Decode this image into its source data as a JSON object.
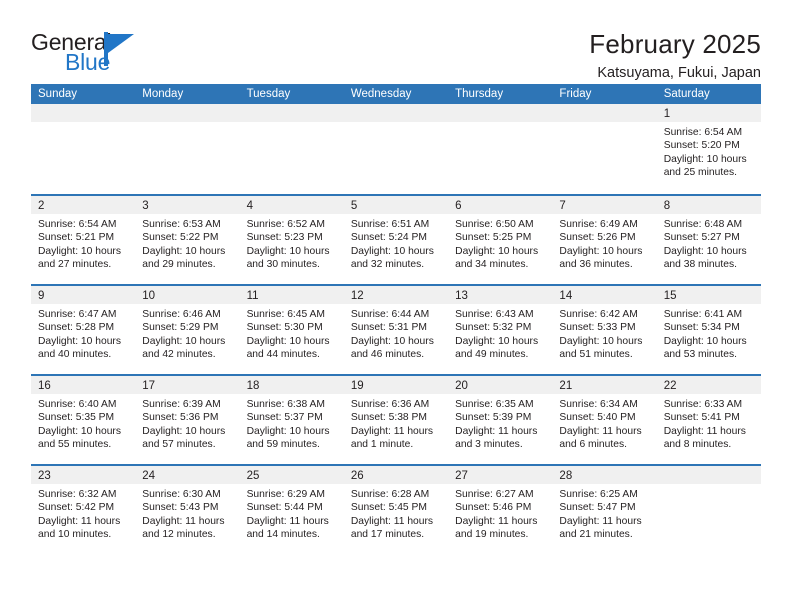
{
  "logo": {
    "text_primary": "General",
    "text_secondary": "Blue",
    "mark": "blue-triangle-flag",
    "color": "#2176c7"
  },
  "header": {
    "month_title": "February 2025",
    "location": "Katsuyama, Fukui, Japan"
  },
  "theme": {
    "header_blue": "#2e75b6",
    "row_divider_blue": "#2e75b6",
    "daynum_band": "#f0f0f0",
    "text": "#231f20"
  },
  "weekdays": [
    "Sunday",
    "Monday",
    "Tuesday",
    "Wednesday",
    "Thursday",
    "Friday",
    "Saturday"
  ],
  "weeks": [
    [
      {
        "day": "",
        "sunrise": "",
        "sunset": "",
        "daylight_a": "",
        "daylight_b": ""
      },
      {
        "day": "",
        "sunrise": "",
        "sunset": "",
        "daylight_a": "",
        "daylight_b": ""
      },
      {
        "day": "",
        "sunrise": "",
        "sunset": "",
        "daylight_a": "",
        "daylight_b": ""
      },
      {
        "day": "",
        "sunrise": "",
        "sunset": "",
        "daylight_a": "",
        "daylight_b": ""
      },
      {
        "day": "",
        "sunrise": "",
        "sunset": "",
        "daylight_a": "",
        "daylight_b": ""
      },
      {
        "day": "",
        "sunrise": "",
        "sunset": "",
        "daylight_a": "",
        "daylight_b": ""
      },
      {
        "day": "1",
        "sunrise": "Sunrise: 6:54 AM",
        "sunset": "Sunset: 5:20 PM",
        "daylight_a": "Daylight: 10 hours",
        "daylight_b": "and 25 minutes."
      }
    ],
    [
      {
        "day": "2",
        "sunrise": "Sunrise: 6:54 AM",
        "sunset": "Sunset: 5:21 PM",
        "daylight_a": "Daylight: 10 hours",
        "daylight_b": "and 27 minutes."
      },
      {
        "day": "3",
        "sunrise": "Sunrise: 6:53 AM",
        "sunset": "Sunset: 5:22 PM",
        "daylight_a": "Daylight: 10 hours",
        "daylight_b": "and 29 minutes."
      },
      {
        "day": "4",
        "sunrise": "Sunrise: 6:52 AM",
        "sunset": "Sunset: 5:23 PM",
        "daylight_a": "Daylight: 10 hours",
        "daylight_b": "and 30 minutes."
      },
      {
        "day": "5",
        "sunrise": "Sunrise: 6:51 AM",
        "sunset": "Sunset: 5:24 PM",
        "daylight_a": "Daylight: 10 hours",
        "daylight_b": "and 32 minutes."
      },
      {
        "day": "6",
        "sunrise": "Sunrise: 6:50 AM",
        "sunset": "Sunset: 5:25 PM",
        "daylight_a": "Daylight: 10 hours",
        "daylight_b": "and 34 minutes."
      },
      {
        "day": "7",
        "sunrise": "Sunrise: 6:49 AM",
        "sunset": "Sunset: 5:26 PM",
        "daylight_a": "Daylight: 10 hours",
        "daylight_b": "and 36 minutes."
      },
      {
        "day": "8",
        "sunrise": "Sunrise: 6:48 AM",
        "sunset": "Sunset: 5:27 PM",
        "daylight_a": "Daylight: 10 hours",
        "daylight_b": "and 38 minutes."
      }
    ],
    [
      {
        "day": "9",
        "sunrise": "Sunrise: 6:47 AM",
        "sunset": "Sunset: 5:28 PM",
        "daylight_a": "Daylight: 10 hours",
        "daylight_b": "and 40 minutes."
      },
      {
        "day": "10",
        "sunrise": "Sunrise: 6:46 AM",
        "sunset": "Sunset: 5:29 PM",
        "daylight_a": "Daylight: 10 hours",
        "daylight_b": "and 42 minutes."
      },
      {
        "day": "11",
        "sunrise": "Sunrise: 6:45 AM",
        "sunset": "Sunset: 5:30 PM",
        "daylight_a": "Daylight: 10 hours",
        "daylight_b": "and 44 minutes."
      },
      {
        "day": "12",
        "sunrise": "Sunrise: 6:44 AM",
        "sunset": "Sunset: 5:31 PM",
        "daylight_a": "Daylight: 10 hours",
        "daylight_b": "and 46 minutes."
      },
      {
        "day": "13",
        "sunrise": "Sunrise: 6:43 AM",
        "sunset": "Sunset: 5:32 PM",
        "daylight_a": "Daylight: 10 hours",
        "daylight_b": "and 49 minutes."
      },
      {
        "day": "14",
        "sunrise": "Sunrise: 6:42 AM",
        "sunset": "Sunset: 5:33 PM",
        "daylight_a": "Daylight: 10 hours",
        "daylight_b": "and 51 minutes."
      },
      {
        "day": "15",
        "sunrise": "Sunrise: 6:41 AM",
        "sunset": "Sunset: 5:34 PM",
        "daylight_a": "Daylight: 10 hours",
        "daylight_b": "and 53 minutes."
      }
    ],
    [
      {
        "day": "16",
        "sunrise": "Sunrise: 6:40 AM",
        "sunset": "Sunset: 5:35 PM",
        "daylight_a": "Daylight: 10 hours",
        "daylight_b": "and 55 minutes."
      },
      {
        "day": "17",
        "sunrise": "Sunrise: 6:39 AM",
        "sunset": "Sunset: 5:36 PM",
        "daylight_a": "Daylight: 10 hours",
        "daylight_b": "and 57 minutes."
      },
      {
        "day": "18",
        "sunrise": "Sunrise: 6:38 AM",
        "sunset": "Sunset: 5:37 PM",
        "daylight_a": "Daylight: 10 hours",
        "daylight_b": "and 59 minutes."
      },
      {
        "day": "19",
        "sunrise": "Sunrise: 6:36 AM",
        "sunset": "Sunset: 5:38 PM",
        "daylight_a": "Daylight: 11 hours",
        "daylight_b": "and 1 minute."
      },
      {
        "day": "20",
        "sunrise": "Sunrise: 6:35 AM",
        "sunset": "Sunset: 5:39 PM",
        "daylight_a": "Daylight: 11 hours",
        "daylight_b": "and 3 minutes."
      },
      {
        "day": "21",
        "sunrise": "Sunrise: 6:34 AM",
        "sunset": "Sunset: 5:40 PM",
        "daylight_a": "Daylight: 11 hours",
        "daylight_b": "and 6 minutes."
      },
      {
        "day": "22",
        "sunrise": "Sunrise: 6:33 AM",
        "sunset": "Sunset: 5:41 PM",
        "daylight_a": "Daylight: 11 hours",
        "daylight_b": "and 8 minutes."
      }
    ],
    [
      {
        "day": "23",
        "sunrise": "Sunrise: 6:32 AM",
        "sunset": "Sunset: 5:42 PM",
        "daylight_a": "Daylight: 11 hours",
        "daylight_b": "and 10 minutes."
      },
      {
        "day": "24",
        "sunrise": "Sunrise: 6:30 AM",
        "sunset": "Sunset: 5:43 PM",
        "daylight_a": "Daylight: 11 hours",
        "daylight_b": "and 12 minutes."
      },
      {
        "day": "25",
        "sunrise": "Sunrise: 6:29 AM",
        "sunset": "Sunset: 5:44 PM",
        "daylight_a": "Daylight: 11 hours",
        "daylight_b": "and 14 minutes."
      },
      {
        "day": "26",
        "sunrise": "Sunrise: 6:28 AM",
        "sunset": "Sunset: 5:45 PM",
        "daylight_a": "Daylight: 11 hours",
        "daylight_b": "and 17 minutes."
      },
      {
        "day": "27",
        "sunrise": "Sunrise: 6:27 AM",
        "sunset": "Sunset: 5:46 PM",
        "daylight_a": "Daylight: 11 hours",
        "daylight_b": "and 19 minutes."
      },
      {
        "day": "28",
        "sunrise": "Sunrise: 6:25 AM",
        "sunset": "Sunset: 5:47 PM",
        "daylight_a": "Daylight: 11 hours",
        "daylight_b": "and 21 minutes."
      },
      {
        "day": "",
        "sunrise": "",
        "sunset": "",
        "daylight_a": "",
        "daylight_b": ""
      }
    ]
  ]
}
